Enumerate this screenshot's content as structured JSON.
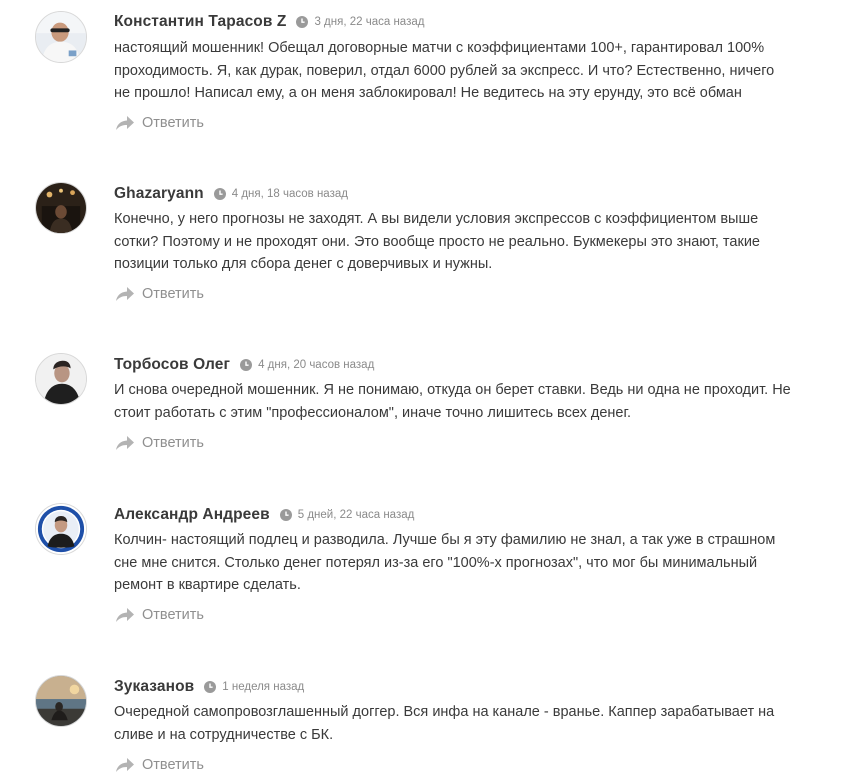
{
  "reply_label": "Ответить",
  "comments": [
    {
      "author": "Константин Тарасов Z",
      "date": "3 дня, 22 часа назад",
      "text": "настоящий мошенник! Обещал договорные матчи с коэффициентами 100+, гарантировал 100% проходимость. Я, как дурак, поверил, отдал 6000 рублей за экспресс. И что? Естественно, ничего не прошло! Написал ему, а он меня заблокировал! Не ведитесь на эту ерунду, это всё обман"
    },
    {
      "author": "Ghazaryann",
      "date": "4 дня, 18 часов назад",
      "text": "Конечно, у него прогнозы не заходят. А вы видели условия экспрессов с коэффициентом выше сотки? Поэтому и не проходят они. Это вообще просто не реально. Букмекеры это знают, такие позиции только для сбора денег с доверчивых и нужны."
    },
    {
      "author": "Торбосов Олег",
      "date": "4 дня, 20 часов назад",
      "text": "И снова очередной мошенник. Я не понимаю, откуда он берет ставки. Ведь ни одна не проходит. Не стоит работать с этим \"профессионалом\", иначе точно лишитесь всех денег."
    },
    {
      "author": "Александр Андреев",
      "date": "5 дней, 22 часа назад",
      "text": "Колчин- настоящий подлец и разводила. Лучше бы я эту фамилию не знал, а так уже в страшном сне мне снится. Столько денег потерял из-за его \"100%-х прогнозах\", что мог бы минимальный ремонт в квартире сделать."
    },
    {
      "author": "Зуказанов",
      "date": "1 неделя назад",
      "text": "Очередной самопровозглашенный доггер. Вся инфа на канале - вранье. Каппер зарабатывает на сливе и на сотрудничестве с БК."
    }
  ]
}
